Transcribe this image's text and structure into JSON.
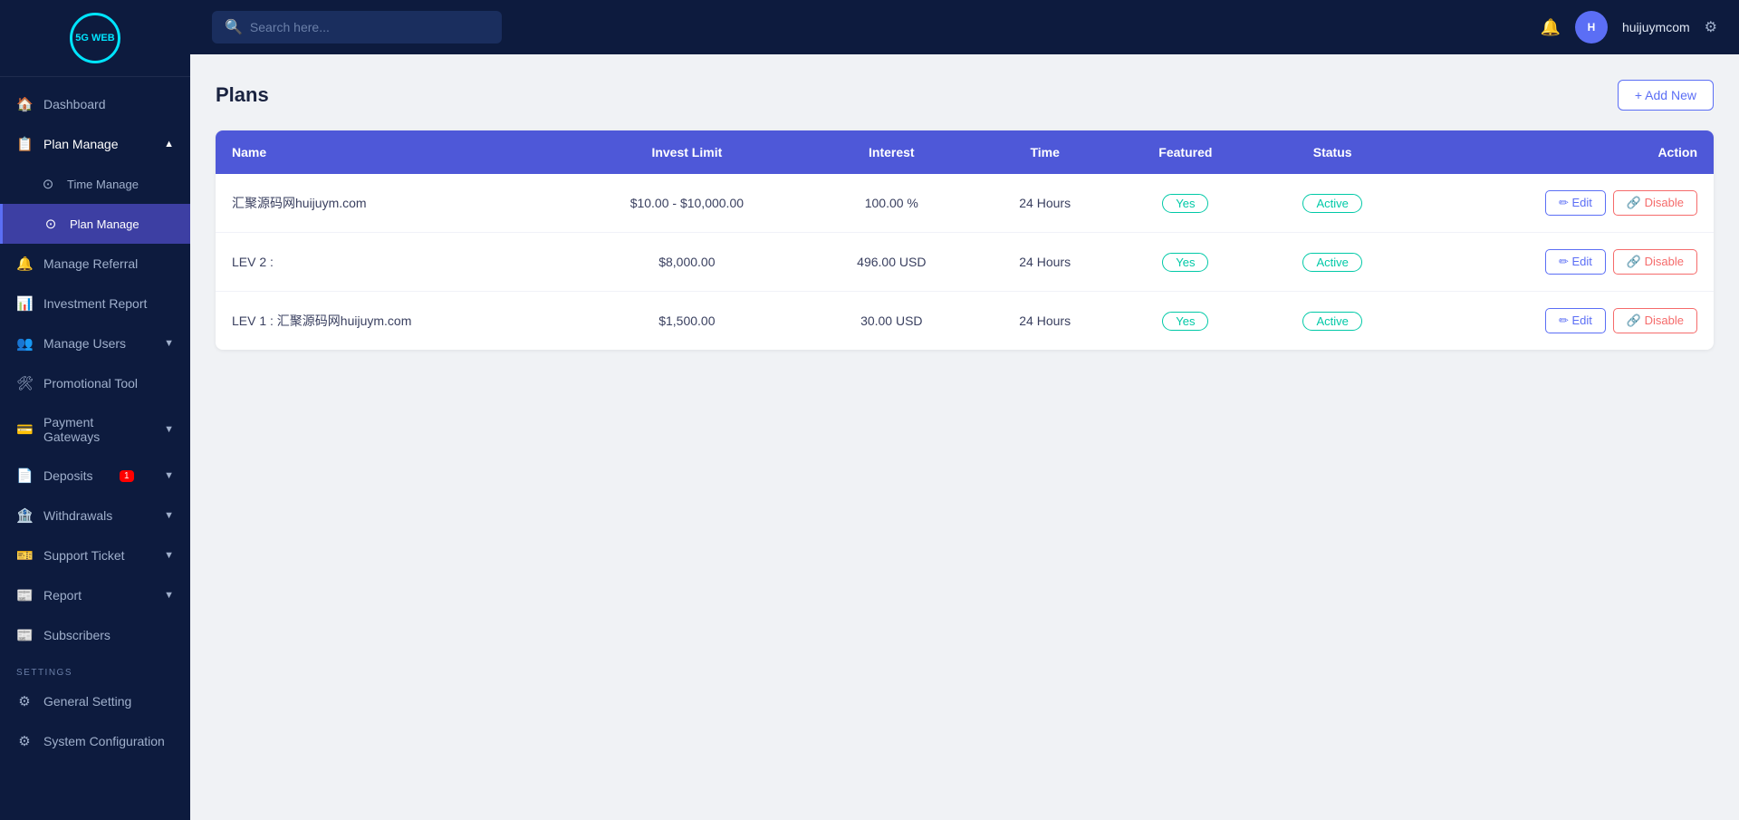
{
  "sidebar": {
    "logo": {
      "text": "5G WEB"
    },
    "items": [
      {
        "id": "dashboard",
        "label": "Dashboard",
        "icon": "🏠",
        "hasChevron": false,
        "active": false
      },
      {
        "id": "plan-manage",
        "label": "Plan Manage",
        "icon": "📋",
        "hasChevron": true,
        "active": true,
        "expanded": true
      },
      {
        "id": "time-manage",
        "label": "Time Manage",
        "icon": "⊙",
        "hasChevron": false,
        "active": false,
        "sub": true
      },
      {
        "id": "plan-manage-sub",
        "label": "Plan Manage",
        "icon": "⊙",
        "hasChevron": false,
        "active": true,
        "sub": true
      },
      {
        "id": "manage-referral",
        "label": "Manage Referral",
        "icon": "🔔",
        "hasChevron": false,
        "active": false
      },
      {
        "id": "investment-report",
        "label": "Investment Report",
        "icon": "📊",
        "hasChevron": false,
        "active": false
      },
      {
        "id": "manage-users",
        "label": "Manage Users",
        "icon": "👥",
        "hasChevron": true,
        "active": false
      },
      {
        "id": "promotional-tool",
        "label": "Promotional Tool",
        "icon": "🛠",
        "hasChevron": false,
        "active": false
      },
      {
        "id": "payment-gateways",
        "label": "Payment Gateways",
        "icon": "💳",
        "hasChevron": true,
        "active": false
      },
      {
        "id": "deposits",
        "label": "Deposits",
        "icon": "📄",
        "hasChevron": true,
        "active": false,
        "badge": "1"
      },
      {
        "id": "withdrawals",
        "label": "Withdrawals",
        "icon": "🏦",
        "hasChevron": true,
        "active": false
      },
      {
        "id": "support-ticket",
        "label": "Support Ticket",
        "icon": "🎫",
        "hasChevron": true,
        "active": false
      },
      {
        "id": "report",
        "label": "Report",
        "icon": "📰",
        "hasChevron": true,
        "active": false
      },
      {
        "id": "subscribers",
        "label": "Subscribers",
        "icon": "📰",
        "hasChevron": false,
        "active": false
      }
    ],
    "settings_label": "SETTINGS",
    "settings_items": [
      {
        "id": "general-setting",
        "label": "General Setting",
        "icon": "⚙"
      },
      {
        "id": "system-configuration",
        "label": "System Configuration",
        "icon": "⚙"
      }
    ]
  },
  "topbar": {
    "search_placeholder": "Search here...",
    "username": "huijuymcom",
    "avatar_text": "H"
  },
  "page": {
    "title": "Plans",
    "add_button_label": "+ Add New"
  },
  "table": {
    "headers": [
      "Name",
      "Invest Limit",
      "Interest",
      "Time",
      "Featured",
      "Status",
      "Action"
    ],
    "rows": [
      {
        "name": "汇聚源码网huijuym.com",
        "invest_limit": "$10.00 - $10,000.00",
        "interest": "100.00 %",
        "time": "24 Hours",
        "featured": "Yes",
        "status": "Active"
      },
      {
        "name": "LEV 2 :",
        "invest_limit": "$8,000.00",
        "interest": "496.00 USD",
        "time": "24 Hours",
        "featured": "Yes",
        "status": "Active"
      },
      {
        "name": "LEV 1 : 汇聚源码网huijuym.com",
        "invest_limit": "$1,500.00",
        "interest": "30.00 USD",
        "time": "24 Hours",
        "featured": "Yes",
        "status": "Active"
      }
    ],
    "edit_label": "Edit",
    "disable_label": "Disable"
  }
}
